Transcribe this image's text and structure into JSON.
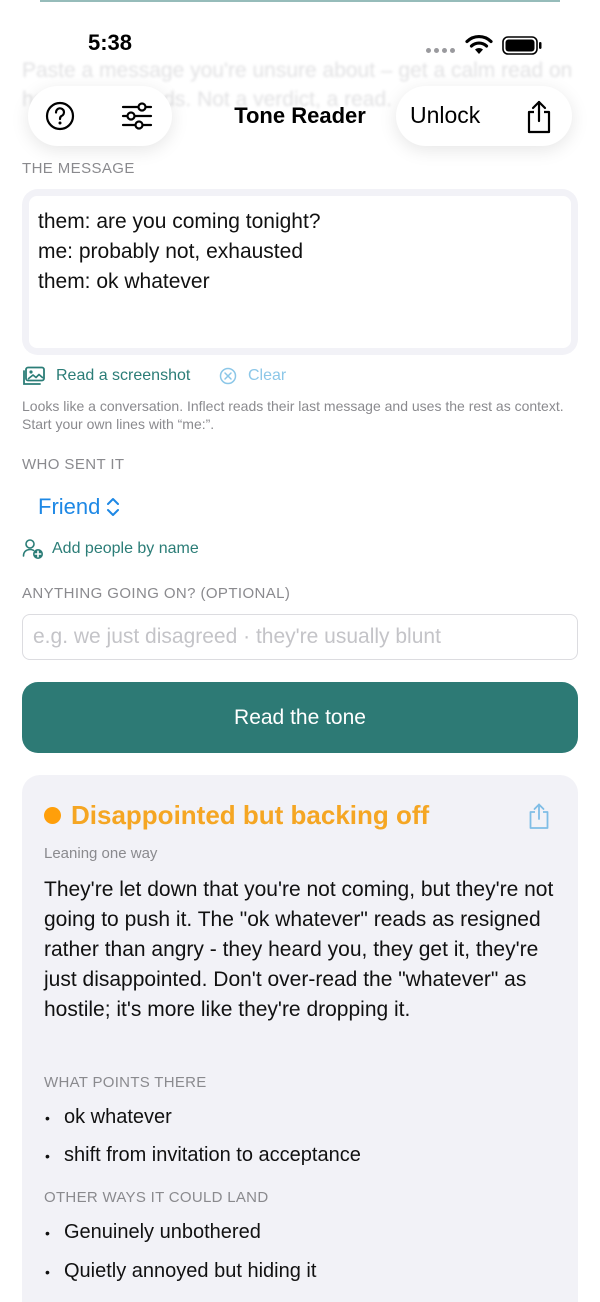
{
  "background_text": "Paste a message you're unsure about – get a calm read on how it likely lands. Not a verdict, a read.",
  "status_bar": {
    "time": "5:38"
  },
  "nav": {
    "title": "Tone Reader",
    "unlock_label": "Unlock",
    "icons": {
      "help": "question-circle-icon",
      "settings": "sliders-icon",
      "share": "share-icon"
    }
  },
  "message_section": {
    "label": "THE MESSAGE",
    "text": "them: are you coming tonight?\nme: probably not, exhausted\nthem: ok whatever",
    "read_screenshot_label": "Read a screenshot",
    "clear_label": "Clear",
    "hint": "Looks like a conversation. Inflect reads their last message and uses the rest as context. Start your own lines with “me:”."
  },
  "sender_section": {
    "label": "WHO SENT IT",
    "selected": "Friend",
    "add_people_label": "Add people by name"
  },
  "context_section": {
    "label": "ANYTHING GOING ON?  (OPTIONAL)",
    "value": "",
    "placeholder": "e.g. we just disagreed · they're usually blunt"
  },
  "read_button_label": "Read the tone",
  "result": {
    "title": "Disappointed but backing off",
    "confidence": "Leaning one way",
    "summary": "They're let down that you're not coming, but they're not going to push it. The \"ok whatever\" reads as resigned rather than angry - they heard you, they get it, they're just disappointed. Don't over-read the \"whatever\" as hostile; it's more like they're dropping it.",
    "evidence_label": "WHAT POINTS THERE",
    "evidence": [
      "ok whatever",
      "shift from invitation to acceptance"
    ],
    "alternatives_label": "OTHER WAYS IT COULD LAND",
    "alternatives": [
      "Genuinely unbothered",
      "Quietly annoyed but hiding it"
    ]
  },
  "colors": {
    "accent": "#2d7a75",
    "link_teal": "#2b7d77",
    "friend_blue": "#1e88e5",
    "tone_orange": "#f5a623",
    "card_bg": "#f2f2f7"
  }
}
